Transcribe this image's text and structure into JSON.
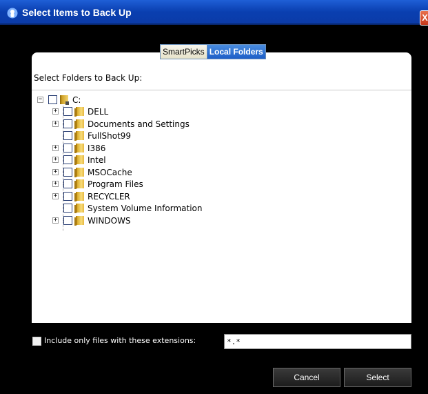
{
  "window": {
    "title": "Select Items to Back Up",
    "close_glyph": "X"
  },
  "tabs": [
    {
      "label": "SmartPicks",
      "active": false
    },
    {
      "label": "Local Folders",
      "active": true
    }
  ],
  "panel": {
    "label": "Select Folders to Back Up:"
  },
  "tree": {
    "root": {
      "label": "C:",
      "expander": "−"
    },
    "items": [
      {
        "label": "DELL",
        "expander": "+"
      },
      {
        "label": "Documents and Settings",
        "expander": "+"
      },
      {
        "label": "FullShot99",
        "expander": ""
      },
      {
        "label": "I386",
        "expander": "+"
      },
      {
        "label": "Intel",
        "expander": "+"
      },
      {
        "label": "MSOCache",
        "expander": "+"
      },
      {
        "label": "Program Files",
        "expander": "+"
      },
      {
        "label": "RECYCLER",
        "expander": "+"
      },
      {
        "label": "System Volume Information",
        "expander": ""
      },
      {
        "label": "WINDOWS",
        "expander": "+"
      }
    ]
  },
  "extensions": {
    "label": "Include only files with these extensions:",
    "value": "*.*",
    "checked": false
  },
  "buttons": {
    "cancel": "Cancel",
    "select": "Select"
  },
  "colors": {
    "titlebar": "#0a3fb0",
    "tab_active": "#1d5ec7",
    "background": "#000000"
  }
}
